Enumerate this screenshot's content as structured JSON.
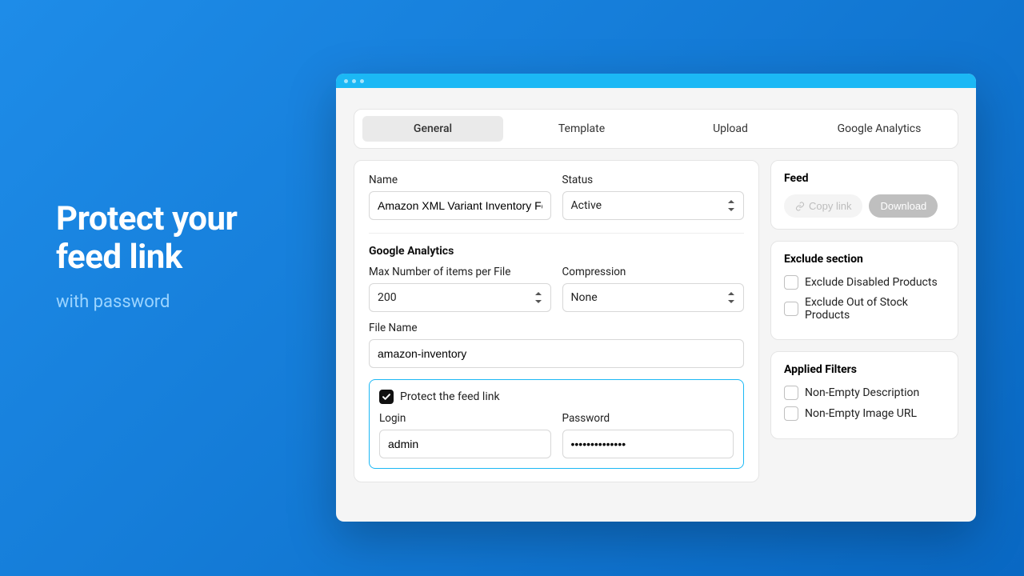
{
  "hero": {
    "title_line1": "Protect your",
    "title_line2": "feed link",
    "subtitle": "with password"
  },
  "tabs": [
    "General",
    "Template",
    "Upload",
    "Google Analytics"
  ],
  "active_tab": 0,
  "form": {
    "name_label": "Name",
    "name_value": "Amazon XML Variant Inventory Feed",
    "status_label": "Status",
    "status_value": "Active",
    "ga_heading": "Google Analytics",
    "max_items_label": "Max Number of items per File",
    "max_items_value": "200",
    "compression_label": "Compression",
    "compression_value": "None",
    "file_name_label": "File Name",
    "file_name_value": "amazon-inventory",
    "protect_label": "Protect the feed link",
    "protect_checked": true,
    "login_label": "Login",
    "login_value": "admin",
    "password_label": "Password",
    "password_value": "••••••••••••••"
  },
  "feed_panel": {
    "title": "Feed",
    "copy_label": "Copy link",
    "download_label": "Download"
  },
  "exclude_panel": {
    "title": "Exclude section",
    "options": [
      {
        "label": "Exclude Disabled Products",
        "checked": false
      },
      {
        "label": "Exclude Out of Stock Products",
        "checked": false
      }
    ]
  },
  "filters_panel": {
    "title": "Applied Filters",
    "options": [
      {
        "label": "Non-Empty Description",
        "checked": false
      },
      {
        "label": "Non-Empty Image URL",
        "checked": false
      }
    ]
  }
}
